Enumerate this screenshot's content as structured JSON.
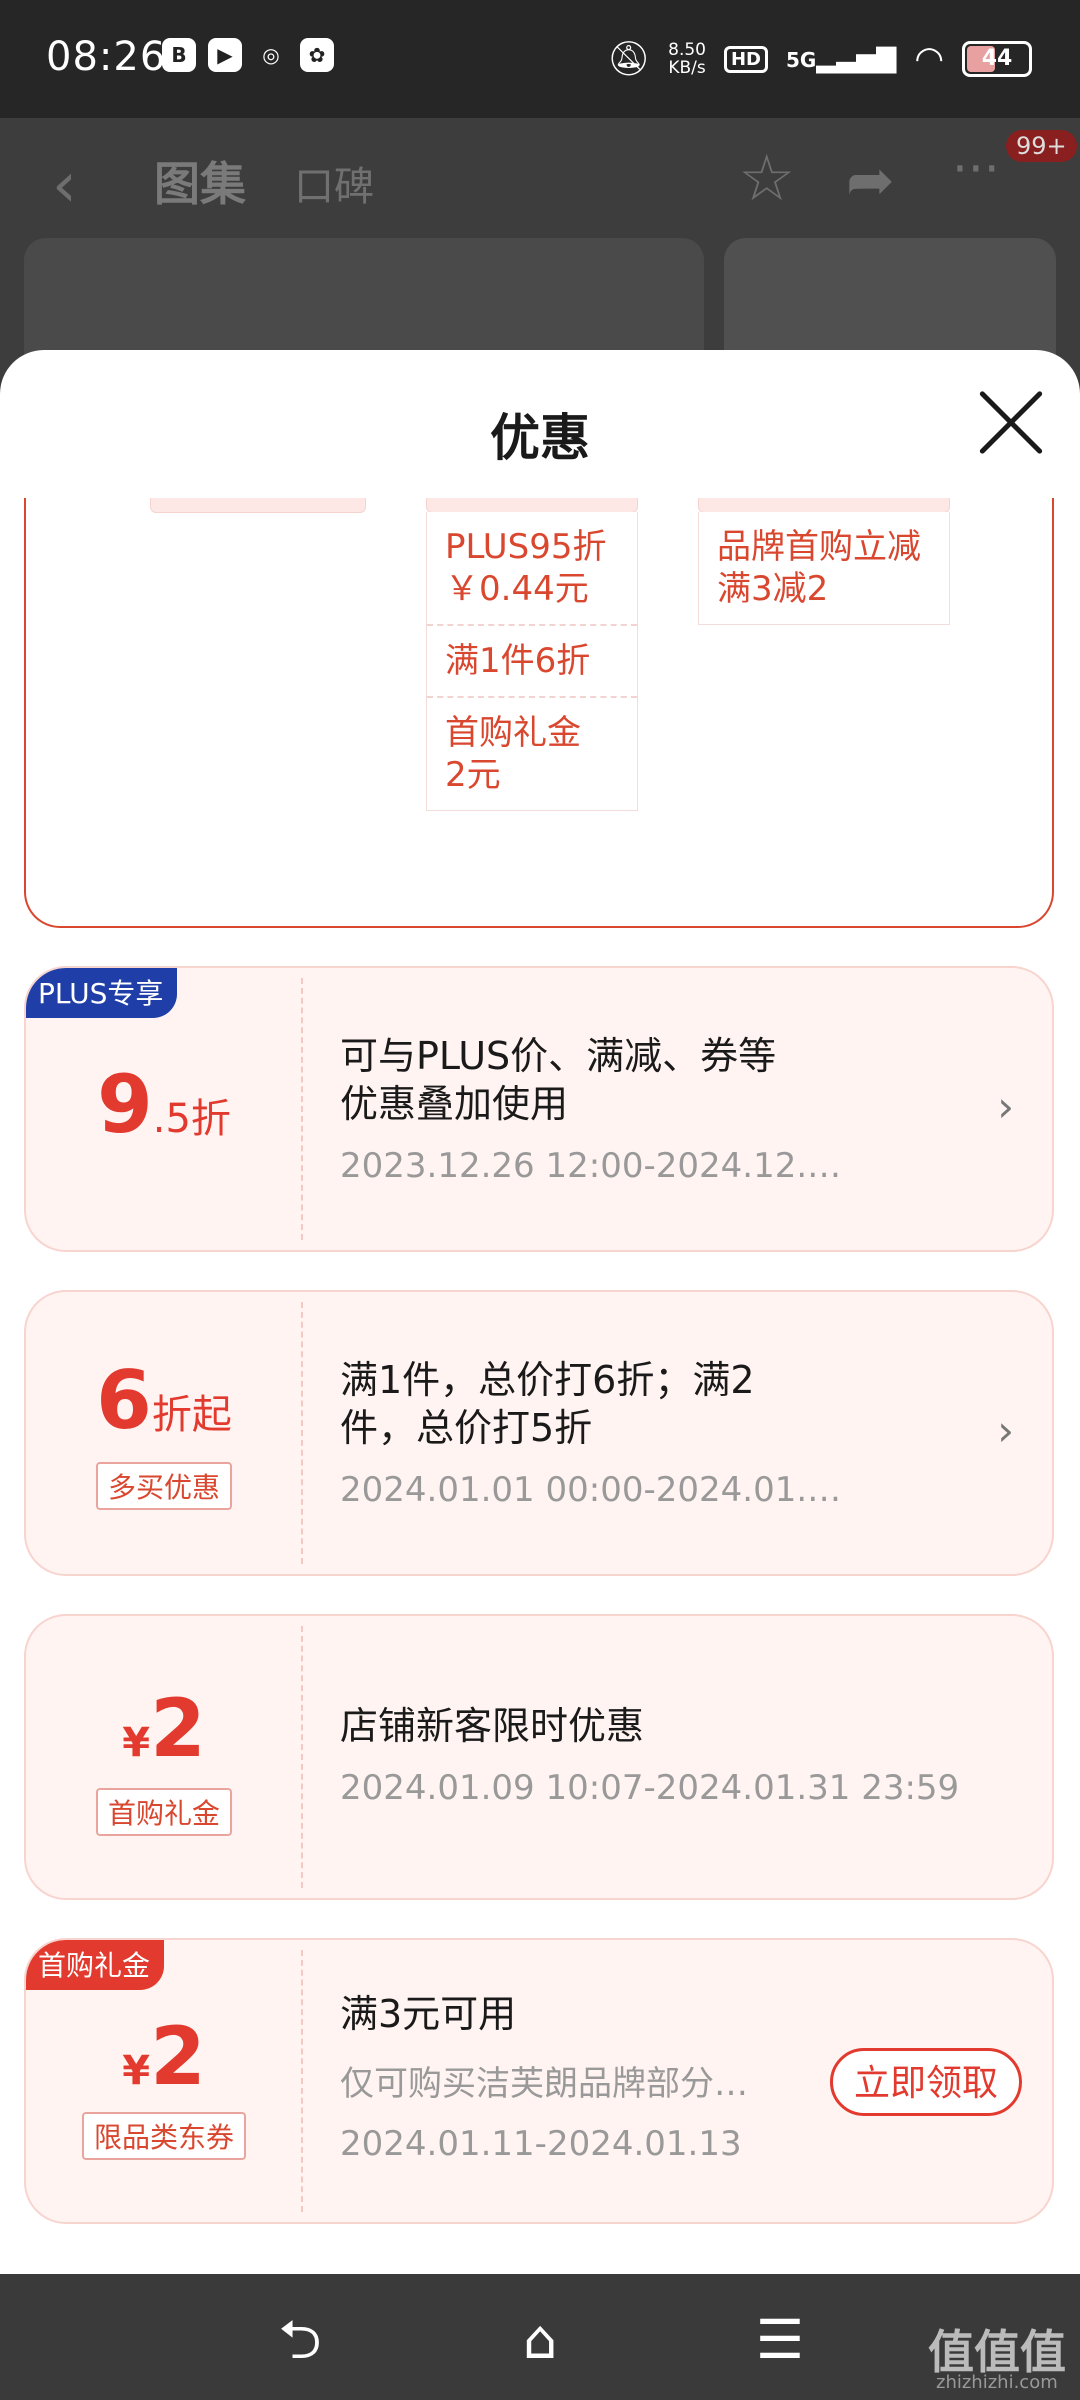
{
  "status_bar": {
    "time": "08:26",
    "network_speed": "8.50",
    "network_unit": "KB/s",
    "hd": "HD",
    "signal": "5G",
    "battery": "44"
  },
  "background_nav": {
    "tab_gallery": "图集",
    "tab_reviews": "口碑",
    "badge": "99+"
  },
  "sheet": {
    "title": "优惠",
    "compare_columns": [
      {
        "items": []
      },
      {
        "items": [
          "PLUS95折\n￥0.44元",
          "满1件6折",
          "首购礼金\n2元"
        ]
      },
      {
        "items": [
          "品牌首购立减\n满3减2"
        ]
      }
    ],
    "coupons": [
      {
        "corner_tag": "PLUS专享",
        "value_main": "9",
        "value_suffix": ".5折",
        "label": "",
        "description": "可与PLUS价、满减、券等\n优惠叠加使用",
        "period": "2023.12.26 12:00-2024.12.2…"
      },
      {
        "corner_tag": "",
        "value_main": "6",
        "value_suffix": "折起",
        "label": "多买优惠",
        "description": "满1件，总价打6折；满2\n件，总价打5折",
        "period": "2024.01.01 00:00-2024.01.3…"
      },
      {
        "corner_tag": "",
        "value_prefix": "¥",
        "value_main": "2",
        "label": "首购礼金",
        "description": "店铺新客限时优惠",
        "period": "2024.01.09 10:07-2024.01.31 23:59"
      },
      {
        "corner_tag": "首购礼金",
        "value_prefix": "¥",
        "value_main": "2",
        "label": "限品类东券",
        "description": "满3元可用",
        "scope": "仅可购买洁芙朗品牌部分…",
        "period": "2024.01.11-2024.01.13",
        "button": "立即领取"
      }
    ]
  },
  "watermark": {
    "logo": "值值值",
    "domain": "zhizhizhi.com"
  },
  "colors": {
    "accent_red": "#e23a2e",
    "plus_blue": "#1f3ea8",
    "card_bg": "#fff4f2"
  }
}
